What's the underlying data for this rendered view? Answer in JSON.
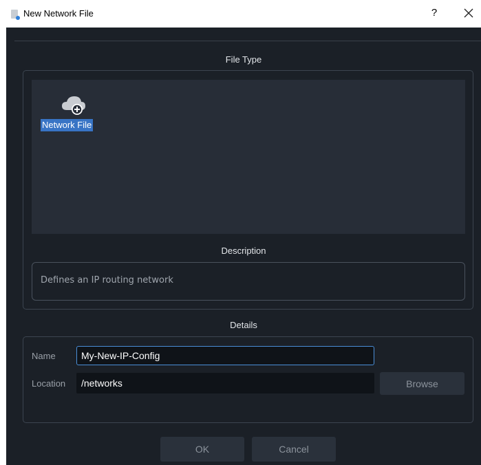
{
  "window": {
    "title": "New Network File",
    "help_glyph": "?",
    "close_glyph": "close-icon"
  },
  "file_type": {
    "heading": "File Type",
    "items": [
      {
        "label": "Network File",
        "icon": "cloud-add-icon",
        "selected": true
      }
    ]
  },
  "description": {
    "heading": "Description",
    "text": "Defines an IP routing network"
  },
  "details": {
    "heading": "Details",
    "name_label": "Name",
    "name_value": "My-New-IP-Config",
    "location_label": "Location",
    "location_value": "/networks",
    "browse_label": "Browse"
  },
  "buttons": {
    "ok_label": "OK",
    "cancel_label": "Cancel"
  },
  "colors": {
    "background": "#1b2027",
    "panel": "#272d37",
    "selection": "#3874c5",
    "focus_border": "#4a8fd9",
    "button": "#2a313b"
  }
}
